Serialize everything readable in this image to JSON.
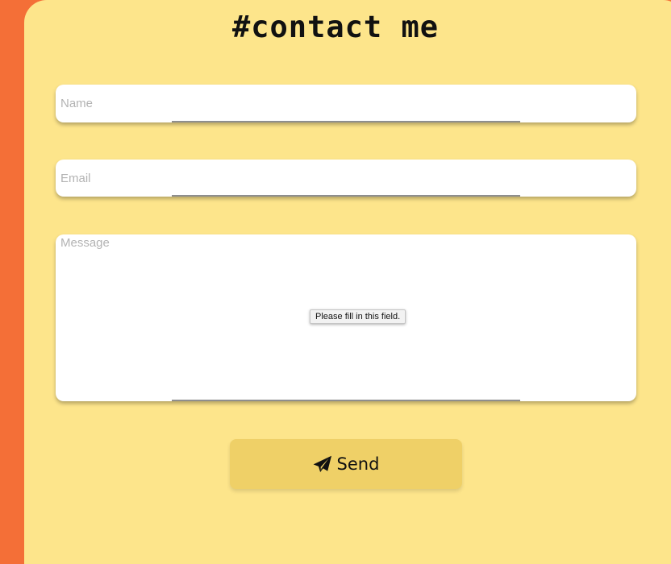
{
  "header": {
    "title": "#contact me"
  },
  "form": {
    "name": {
      "placeholder": "Name",
      "value": ""
    },
    "email": {
      "placeholder": "Email",
      "value": ""
    },
    "message": {
      "placeholder": "Message",
      "value": ""
    },
    "validation_tooltip": "Please fill in this field.",
    "send_label": "Send",
    "send_icon": "paper-plane-icon"
  },
  "colors": {
    "page_background": "#f46f37",
    "panel_background": "#fde58b",
    "button_background": "#efd067",
    "placeholder": "#b3b3b3"
  }
}
